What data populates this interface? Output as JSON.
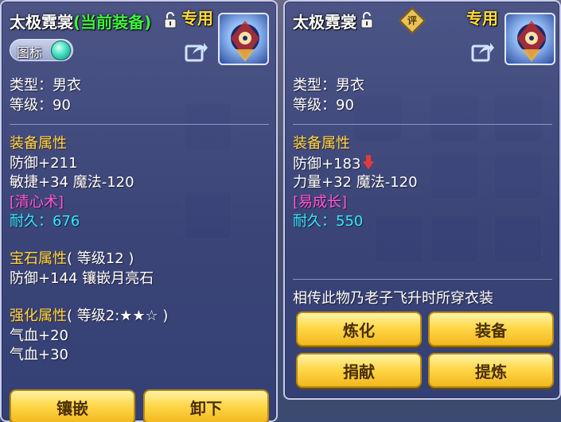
{
  "left": {
    "title": "太极霓裳",
    "equipped_tag": "(当前装备)",
    "exclusive_label": "专用",
    "toggle_label": "图标",
    "type_line": "类型：男衣",
    "level_line": "等级：90",
    "attr_header": "装备属性",
    "attr_lines": [
      "防御+211",
      "敏捷+34 魔法-120"
    ],
    "special_tag": "[清心术]",
    "durability": "耐久：676",
    "gem_header": "宝石属性",
    "gem_level": "( 等级12 )",
    "gem_line": "防御+144 镶嵌月亮石",
    "enhance_header": "强化属性",
    "enhance_level": "( 等级2:★★☆ )",
    "enhance_lines": [
      "气血+20",
      "气血+30"
    ],
    "buttons": [
      "镶嵌",
      "卸下"
    ]
  },
  "right": {
    "title": "太极霓裳",
    "rate_label": "评",
    "exclusive_label": "专用",
    "type_line": "类型：男衣",
    "level_line": "等级：90",
    "attr_header": "装备属性",
    "attr_lines": [
      "防御+183",
      "力量+32 魔法-120"
    ],
    "special_tag": "[易成长]",
    "durability": "耐久：550",
    "description": "相传此物乃老子飞升时所穿衣装",
    "buttons": [
      "炼化",
      "装备",
      "捐献",
      "提炼"
    ]
  },
  "colors": {
    "gold": "#ffd84a",
    "cyan": "#36e7ff",
    "pink": "#ff5ad2",
    "green": "#3ef23e",
    "decrease_arrow": "#e83a3a"
  }
}
